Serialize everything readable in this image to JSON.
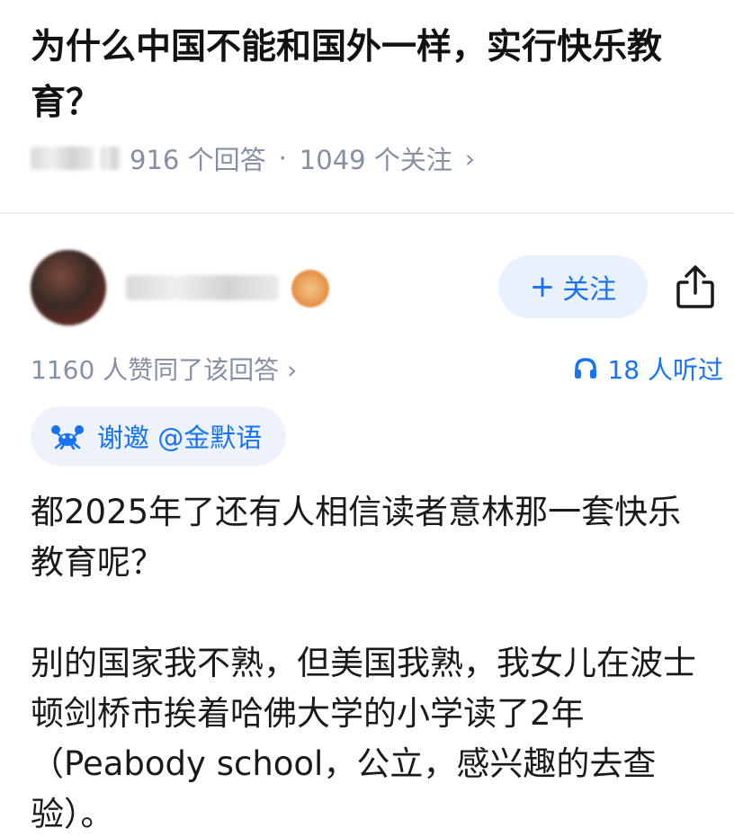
{
  "question": {
    "title": "为什么中国不能和国外一样，实行快乐教育？",
    "answers_count": "916 个回答",
    "separator": "·",
    "followers_count": "1049 个关注",
    "chevron": "›"
  },
  "author": {
    "follow_label": "关注",
    "follow_plus": "+"
  },
  "answer": {
    "vote_text": "1160 人赞同了该回答 ›",
    "listen_text": "18 人听过",
    "invite_text": "谢邀 @金默语",
    "paragraphs": [
      "都2025年了还有人相信读者意林那一套快乐教育呢？",
      "别的国家我不熟，但美国我熟，我女儿在波士顿剑桥市挨着哈佛大学的小学读了2年（Peabody school，公立，感兴趣的去查验）。"
    ]
  },
  "colors": {
    "accent": "#1772f6",
    "meta": "#8590a6",
    "follow_bg": "#e8f1fd",
    "invite_bg": "#eef3fb"
  },
  "icons": [
    "share-icon",
    "headphone-icon",
    "crab-icon",
    "plus-icon",
    "chevron-right-icon"
  ]
}
